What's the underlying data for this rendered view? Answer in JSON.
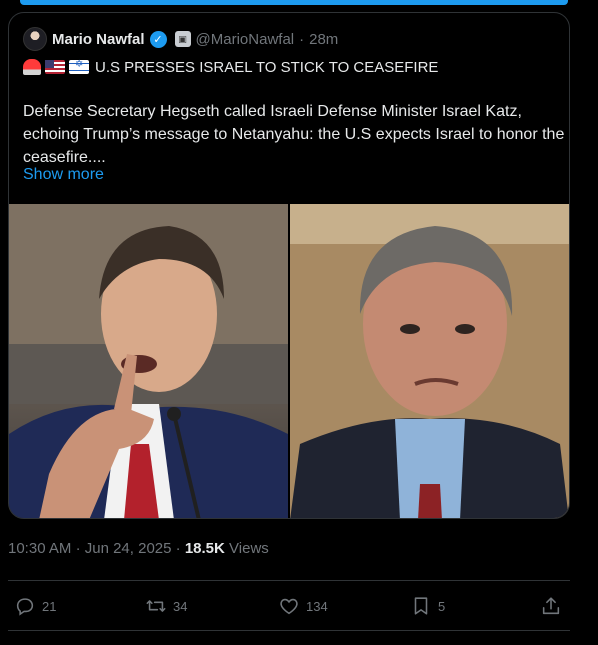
{
  "tweet": {
    "author": {
      "name": "Mario Nawfal",
      "handle": "@MarioNawfal",
      "age": "28m"
    },
    "headline": "U.S PRESSES ISRAEL TO STICK TO CEASEFIRE",
    "emojis": [
      "siren-emoji",
      "us-flag-emoji",
      "israel-flag-emoji"
    ],
    "body": "Defense Secretary Hegseth called Israeli Defense Minister Israel Katz, echoing Trump’s message to Netanyahu: the U.S expects Israel to honor the ceasefire....",
    "show_more": "Show more"
  },
  "meta": {
    "time": "10:30 AM",
    "date": "Jun 24, 2025",
    "views_count": "18.5K",
    "views_label": "Views"
  },
  "actions": {
    "replies": "21",
    "reposts": "34",
    "likes": "134",
    "bookmarks": "5"
  },
  "colors": {
    "accent": "#1d9bf0",
    "muted": "#71767b",
    "text": "#e7e9ea",
    "border": "#2f3336",
    "background": "#000000"
  }
}
